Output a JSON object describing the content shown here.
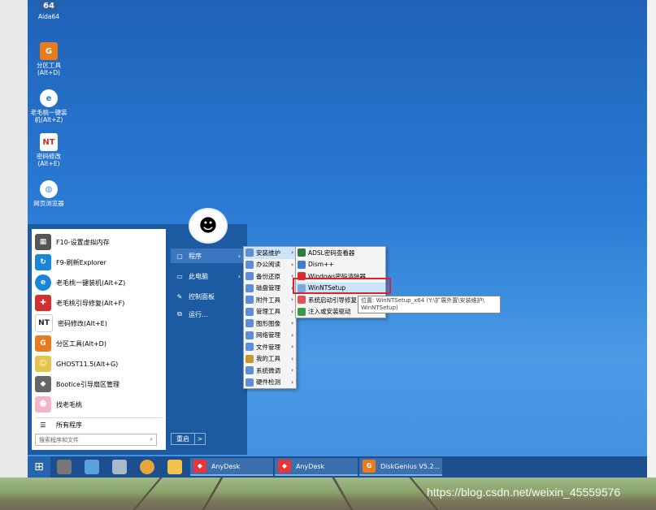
{
  "desktop": {
    "icons": [
      {
        "label": "Aida64",
        "glyph": "64",
        "color": "#2a5fa0"
      },
      {
        "label": "分区工具(Alt+D)",
        "glyph": "G",
        "color": "#e87b1c"
      },
      {
        "label": "老毛桃一键装机(Alt+Z)",
        "glyph": "e",
        "color": "#1a86d9"
      },
      {
        "label": "密码修改(Alt+E)",
        "glyph": "NT",
        "color": "#ffffff"
      },
      {
        "label": "网页浏览器",
        "glyph": "◍",
        "color": "#4c8fd6"
      }
    ]
  },
  "start_menu": {
    "left_items": [
      {
        "label": "F10-设置虚拟内存",
        "glyph": "▦",
        "color": "#555555"
      },
      {
        "label": "F9-刷新Explorer",
        "glyph": "↻",
        "color": "#1a86d9"
      },
      {
        "label": "老毛桃一键装机(Alt+Z)",
        "glyph": "e",
        "color": "#1a86d9"
      },
      {
        "label": "老毛桃引导修复(Alt+F)",
        "glyph": "✚",
        "color": "#d22f2f"
      },
      {
        "label": "密码修改(Alt+E)",
        "glyph": "NT",
        "color": "#222222"
      },
      {
        "label": "分区工具(Alt+D)",
        "glyph": "G",
        "color": "#e87b1c"
      },
      {
        "label": "GHOST11.5(Alt+G)",
        "glyph": "☺",
        "color": "#e6c34a"
      },
      {
        "label": "Bootice引导扇区管理",
        "glyph": "◆",
        "color": "#666666"
      },
      {
        "label": "找老毛桃",
        "glyph": "☻",
        "color": "#f3b6c6"
      }
    ],
    "all_programs": "所有程序",
    "search_placeholder": "搜索程序和文件",
    "right_items": [
      {
        "label": "程序",
        "glyph": "▢"
      },
      {
        "label": "此电脑",
        "glyph": "▭"
      },
      {
        "label": "控制面板",
        "glyph": "✎"
      },
      {
        "label": "运行...",
        "glyph": "⧉"
      }
    ],
    "restart": "重启",
    "restart_arrow": ">"
  },
  "programs_menu": {
    "items": [
      "安装维护",
      "办公阅读",
      "备份还原",
      "磁盘管理",
      "附件工具",
      "管理工具",
      "图形图像",
      "网络管理",
      "文件管理",
      "我的工具",
      "系统微调",
      "硬件检测"
    ]
  },
  "install_menu": {
    "items": [
      "ADSL密码查看器",
      "Dism++",
      "Windows密码清除器",
      "WinNTSetup",
      "系统启动引导修复",
      "注入或安装驱动"
    ],
    "tooltip": "位置: WinNTSetup_x64 (Y:\\扩展外置\\安装维护\\ WinNTSetup)"
  },
  "taskbar": {
    "apps": [
      {
        "label": "AnyDesk",
        "glyph": "◆",
        "color": "#e8353a"
      },
      {
        "label": "AnyDesk",
        "glyph": "◆",
        "color": "#e8353a"
      },
      {
        "label": "DiskGenius V5.2...",
        "glyph": "G",
        "color": "#e87b1c"
      }
    ]
  },
  "watermark": "https://blog.csdn.net/weixin_45559576"
}
